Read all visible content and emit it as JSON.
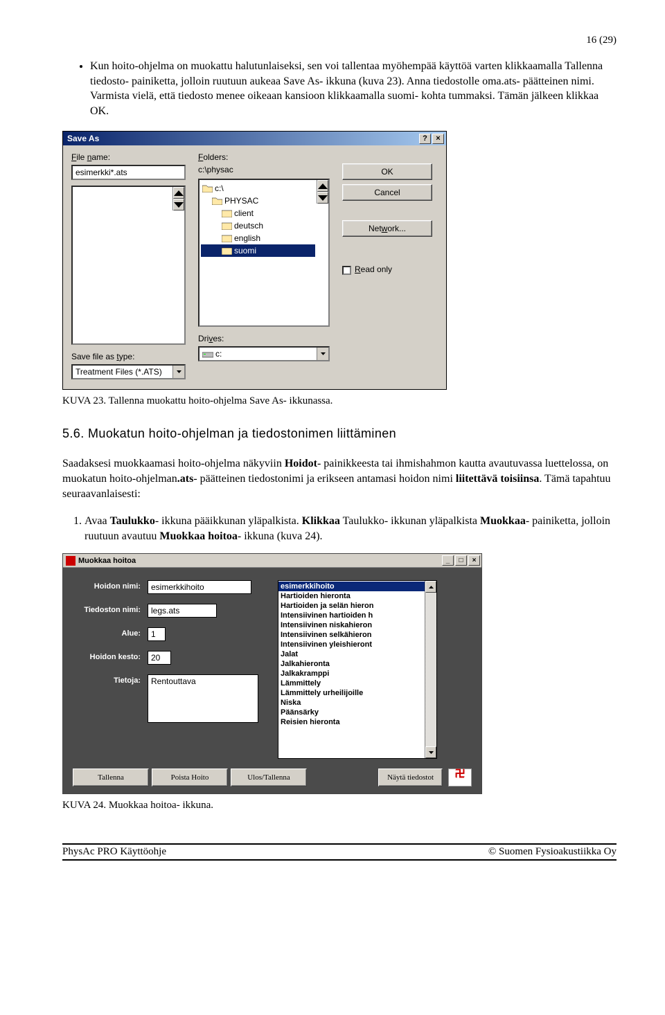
{
  "page_number": "16 (29)",
  "bullet_text": "Kun hoito-ohjelma on muokattu halutunlaiseksi, sen voi tallentaa myöhempää käyttöä varten klikkaamalla Tallenna tiedosto- painiketta, jolloin ruutuun aukeaa Save As- ikkuna (kuva 23). Anna tiedostolle oma.ats- päätteinen nimi. Varmista vielä, että tiedosto menee oikeaan kansioon klikkaamalla suomi- kohta tummaksi. Tämän jälkeen klikkaa OK.",
  "saveas": {
    "title": "Save As",
    "file_name_label": "File name:",
    "file_name_value": "esimerkki*.ats",
    "folders_label": "Folders:",
    "folders_path": "c:\\physac",
    "save_type_label": "Save file as type:",
    "save_type_value": "Treatment Files (*.ATS)",
    "drives_label": "Drives:",
    "drives_value": "c:",
    "ok": "OK",
    "cancel": "Cancel",
    "network": "Network...",
    "read_only": "Read only",
    "tree": {
      "root": "c:\\",
      "l1": "PHYSAC",
      "items": [
        "client",
        "deutsch",
        "english",
        "suomi"
      ]
    }
  },
  "caption23": "KUVA 23. Tallenna muokattu hoito-ohjelma Save As- ikkunassa.",
  "section": "5.6. Muokatun hoito-ohjelman ja tiedostonimen liittäminen",
  "para1a": "Saadaksesi muokkaamasi hoito-ohjelma näkyviin ",
  "para1b": "Hoidot",
  "para1c": "- painikkeesta tai ihmishahmon kautta avautuvassa luettelossa, on muokatun hoito-ohjelman",
  "para1d": ".ats",
  "para1e": "- päätteinen tiedostonimi ja erikseen antamasi hoidon nimi ",
  "para1f": "liitettävä toisiinsa",
  "para1g": ". Tämä tapahtuu seuraavanlaisesti:",
  "step1a": "Avaa ",
  "step1b": "Taulukko",
  "step1c": "- ikkuna pääikkunan yläpalkista. ",
  "step1d": "Klikkaa",
  "step1e": " Taulukko- ikkunan yläpalkista ",
  "step1f": "Muokkaa",
  "step1g": "- painiketta, jolloin ruutuun avautuu ",
  "step1h": "Muokkaa hoitoa",
  "step1i": "- ikkuna (kuva 24).",
  "muokkaa": {
    "title": "Muokkaa hoitoa",
    "labels": {
      "hoidon_nimi": "Hoidon nimi:",
      "tiedoston_nimi": "Tiedoston nimi:",
      "alue": "Alue:",
      "hoidon_kesto": "Hoidon kesto:",
      "tietoja": "Tietoja:"
    },
    "values": {
      "hoidon_nimi": "esimerkkihoito",
      "tiedoston_nimi": "legs.ats",
      "alue": "1",
      "hoidon_kesto": "20",
      "tietoja": "Rentouttava"
    },
    "list": [
      "esimerkkihoito",
      "Hartioiden hieronta",
      "Hartioiden ja selän hieron",
      "Intensiivinen hartioiden h",
      "Intensiivinen niskahieron",
      "Intensiivinen selkähieron",
      "Intensiivinen yleishieront",
      "Jalat",
      "Jalkahieronta",
      "Jalkakramppi",
      "Lämmittely",
      "Lämmittely urheilijoille",
      "Niska",
      "Päänsärky",
      "Reisien hieronta"
    ],
    "buttons": {
      "tallenna": "Tallenna",
      "poista": "Poista Hoito",
      "ulos": "Ulos/Tallenna",
      "nayta": "Näytä tiedostot"
    }
  },
  "caption24": "KUVA 24. Muokkaa hoitoa- ikkuna.",
  "footer_left": "PhysAc PRO Käyttöohje",
  "footer_right": "© Suomen Fysioakustiikka Oy"
}
